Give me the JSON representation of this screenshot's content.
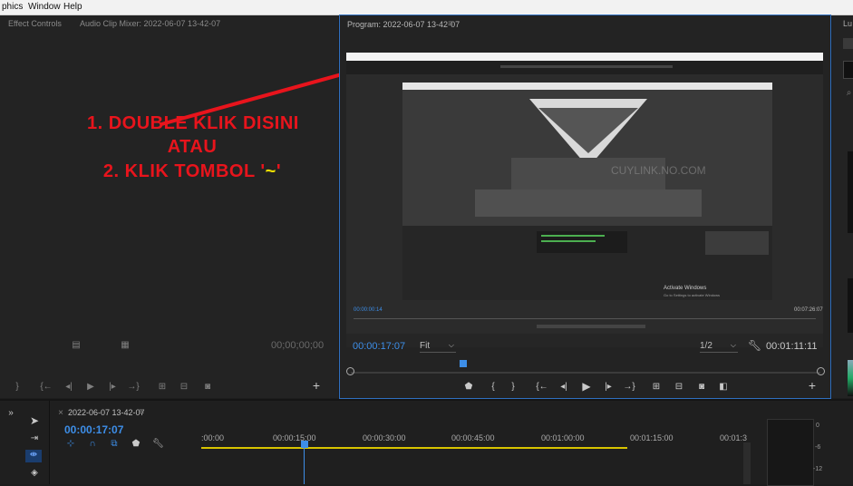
{
  "menubar": {
    "items": [
      "phics",
      "Window",
      "Help"
    ]
  },
  "left_panel": {
    "tab_effect_controls": "Effect Controls",
    "tab_audio_mixer": "Audio Clip Mixer: 2022-06-07 13-42-07",
    "source_timecode": "00;00;00;00"
  },
  "annotation": {
    "line1": "1. DOUBLE KLIK DISINI",
    "line2": "ATAU",
    "line3_prefix": "2. KLIK TOMBOL '",
    "line3_key": "~",
    "line3_suffix": "'",
    "arrow_color": "#e8141c",
    "key_color": "#f0e000"
  },
  "program_monitor": {
    "title": "Program: 2022-06-07 13-42-07",
    "menu_icon": "hamburger-icon",
    "current_time": "00:00:17:07",
    "fit_label": "Fit",
    "resolution": "1/2",
    "duration": "00:01:11:11",
    "playhead_fraction": 0.24,
    "accent_color": "#3d8ee8"
  },
  "nested_video": {
    "watermark": "CUYLINK.NO.COM",
    "inner_timecode": "00:00:00:14",
    "inner_duration": "00:07:26:07",
    "activate_windows": "Activate Windows",
    "activate_windows_sub": "Go to Settings to activate Windows"
  },
  "right_panel": {
    "tab_label": "Lu"
  },
  "timeline": {
    "sequence_name": "2022-06-07 13-42-07",
    "current_time": "00:00:17:07",
    "ruler_labels": [
      ":00:00",
      "00:00:15:00",
      "00:00:30:00",
      "00:00:45:00",
      "00:01:00:00",
      "00:01:15:00",
      "00:01:3"
    ],
    "meter_labels": [
      "0",
      "-6",
      "-12"
    ]
  }
}
